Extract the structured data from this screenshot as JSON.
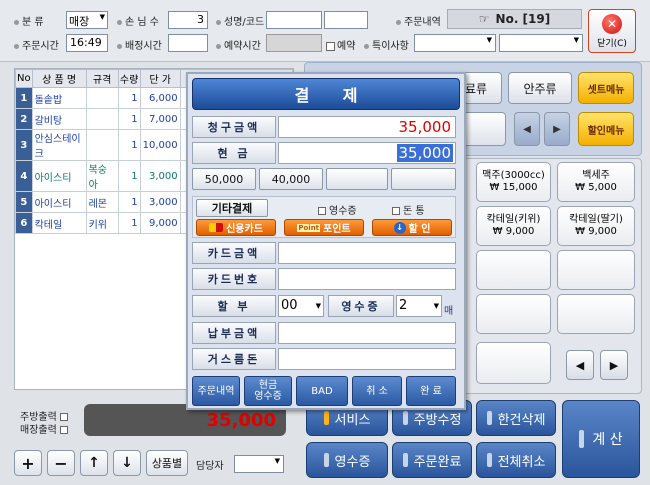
{
  "header": {
    "category_label": "분   류",
    "category_value": "매장",
    "guests_label": "손 님 수",
    "guests_value": "3",
    "name_code_label": "성명/코드",
    "order_history_label": "주문내역",
    "order_no": "No. [19]",
    "order_time_label": "주문시간",
    "order_time_value": "16:49",
    "delivery_time_label": "배정시간",
    "reservation_time_label": "예약시간",
    "reservation_check": "예약",
    "special_label": "특이사항",
    "close_label": "닫기(C)"
  },
  "order_table": {
    "headers": [
      "No",
      "상 품 명",
      "규격",
      "수량",
      "단 가"
    ],
    "rows": [
      {
        "no": "1",
        "name": "돌솥밥",
        "spec": "",
        "qty": "1",
        "price": "6,000"
      },
      {
        "no": "2",
        "name": "갈비탕",
        "spec": "",
        "qty": "1",
        "price": "7,000"
      },
      {
        "no": "3",
        "name": "안심스테이크",
        "spec": "",
        "qty": "1",
        "price": "10,000"
      },
      {
        "no": "4",
        "name": "아이스티",
        "spec": "복숭아",
        "qty": "1",
        "price": "3,000"
      },
      {
        "no": "5",
        "name": "아이스티",
        "spec": "레몬",
        "qty": "1",
        "price": "3,000"
      },
      {
        "no": "6",
        "name": "칵테일",
        "spec": "키위",
        "qty": "1",
        "price": "9,000"
      }
    ]
  },
  "left_bottom": {
    "kitchen_print": "주방출력",
    "counter_print": "매장출력",
    "total": "35,000",
    "plus": "+",
    "minus": "−",
    "up": "↑",
    "down": "↓",
    "by_product": "상품별",
    "staff_label": "담당자"
  },
  "right_panel": {
    "category_tab1": "료류",
    "category_tab2": "안주류",
    "set_menu": "셋트메뉴",
    "discount_menu": "할인메뉴",
    "menu_items": [
      {
        "name": "맥주(3000cc)",
        "price": "₩ 15,000"
      },
      {
        "name": "백세주",
        "price": "₩ 5,000"
      },
      {
        "name": "칵테일(키위)",
        "price": "₩ 9,000"
      },
      {
        "name": "칵테일(딸기)",
        "price": "₩ 9,000"
      }
    ],
    "service": "서비스",
    "kitchen_fix": "주방수정",
    "delete_one": "한건삭제",
    "receipt": "영수증",
    "order_complete": "주문완료",
    "cancel_all": "전체취소",
    "calculate": "계 산"
  },
  "dialog": {
    "title": "결      제",
    "billed_label": "청구금액",
    "billed_value": "35,000",
    "cash_label": "현   금",
    "cash_value": "35,000",
    "quick_amounts": [
      "50,000",
      "40,000",
      "",
      ""
    ],
    "other_payment": "기타결제",
    "receipt_check": "영수증",
    "money_check": "돈 통",
    "credit_card": "신용카드",
    "point": "포인트",
    "point_logo": "Point",
    "discount": "할  인",
    "card_amount_label": "카드금액",
    "card_number_label": "카드번호",
    "installment_label": "할   부",
    "installment_value": "00",
    "receipt_label": "영수증",
    "receipt_value": "2",
    "receipt_unit": "매",
    "paid_amount_label": "납부금액",
    "change_label": "거스름돈",
    "btn_order_history": "주문내역",
    "btn_cash_receipt": "현금\n영수증",
    "btn_bad": "BAD",
    "btn_cancel": "취  소",
    "btn_complete": "완  료"
  },
  "colors": {
    "blue_dark": "#2b5aa3",
    "red_total": "#e00000",
    "dialog_bg": "#dde3ee"
  }
}
